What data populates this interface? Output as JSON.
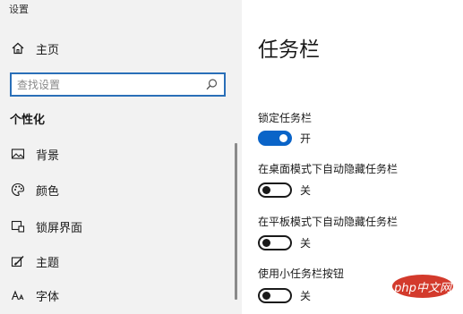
{
  "app": {
    "title": "设置"
  },
  "sidebar": {
    "home_label": "主页",
    "search_placeholder": "查找设置",
    "section_heading": "个性化",
    "items": [
      {
        "label": "背景",
        "icon": "image-icon"
      },
      {
        "label": "颜色",
        "icon": "palette-icon"
      },
      {
        "label": "锁屏界面",
        "icon": "lock-screen-icon"
      },
      {
        "label": "主题",
        "icon": "theme-icon"
      },
      {
        "label": "字体",
        "icon": "font-icon"
      }
    ]
  },
  "main": {
    "title": "任务栏",
    "settings": [
      {
        "label": "锁定任务栏",
        "state": "开",
        "on": true
      },
      {
        "label": "在桌面模式下自动隐藏任务栏",
        "state": "关",
        "on": false
      },
      {
        "label": "在平板模式下自动隐藏任务栏",
        "state": "关",
        "on": false
      },
      {
        "label": "使用小任务栏按钮",
        "state": "关",
        "on": false
      }
    ]
  },
  "watermark": {
    "text": "php中文网",
    "color": "#d33a2c"
  },
  "colors": {
    "accent": "#0a64c8",
    "sidebar_bg": "#f2f2f2",
    "search_border": "#2a6fb8"
  }
}
